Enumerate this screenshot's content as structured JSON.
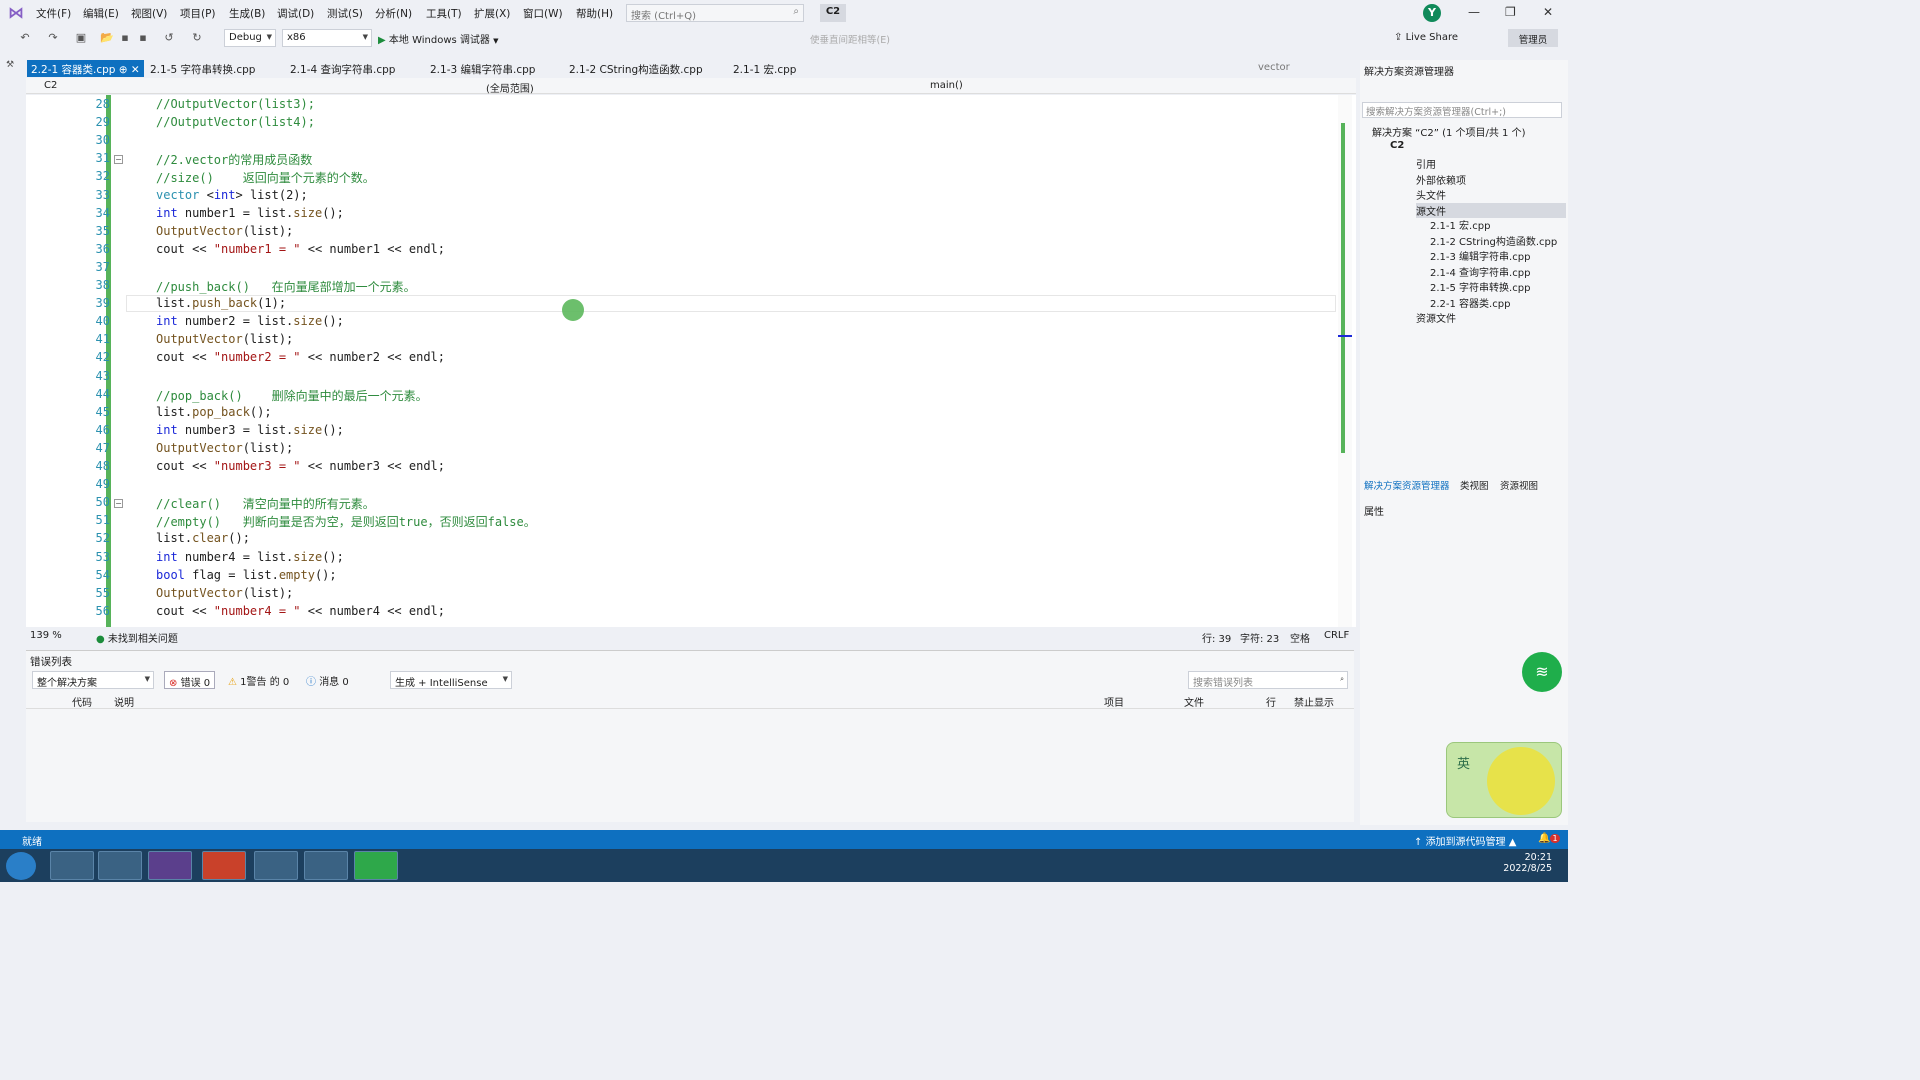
{
  "menu": [
    "文件(F)",
    "编辑(E)",
    "视图(V)",
    "项目(P)",
    "生成(B)",
    "调试(D)",
    "测试(S)",
    "分析(N)",
    "工具(T)",
    "扩展(X)",
    "窗口(W)",
    "帮助(H)"
  ],
  "search_placeholder": "搜索 (Ctrl+Q)",
  "solution_badge": "C2",
  "avatar_letter": "Y",
  "toolbar": {
    "config": "Debug",
    "platform": "x86",
    "run_label": "本地 Windows 调试器",
    "live_share": "Live Share",
    "admin": "管理员",
    "disabled_label": "使垂直间距相等(E)"
  },
  "tabs": [
    {
      "label": "2.2-1 容器类.cpp",
      "active": true
    },
    {
      "label": "2.1-5 字符串转换.cpp"
    },
    {
      "label": "2.1-4 查询字符串.cpp"
    },
    {
      "label": "2.1-3 编辑字符串.cpp"
    },
    {
      "label": "2.1-2 CString构造函数.cpp"
    },
    {
      "label": "2.1-1 宏.cpp"
    }
  ],
  "tab_overflow": "vector",
  "nav": {
    "project": "C2",
    "scope": "(全局范围)",
    "member": "main()"
  },
  "lines": [
    {
      "n": "28",
      "t": "//OutputVector(list3);"
    },
    {
      "n": "29",
      "t": "//OutputVector(list4);"
    },
    {
      "n": "30",
      "t": ""
    },
    {
      "n": "31",
      "t": "//2.vector的常用成员函数"
    },
    {
      "n": "32",
      "t": "//size()    返回向量个元素的个数。"
    },
    {
      "n": "33",
      "t": "vector <int> list(2);"
    },
    {
      "n": "34",
      "t": "int number1 = list.size();"
    },
    {
      "n": "35",
      "t": "OutputVector(list);"
    },
    {
      "n": "36",
      "t": "cout << \"number1 = \" << number1 << endl;"
    },
    {
      "n": "37",
      "t": ""
    },
    {
      "n": "38",
      "t": "//push_back()   在向量尾部增加一个元素。"
    },
    {
      "n": "39",
      "t": "list.push_back(1);"
    },
    {
      "n": "40",
      "t": "int number2 = list.size();"
    },
    {
      "n": "41",
      "t": "OutputVector(list);"
    },
    {
      "n": "42",
      "t": "cout << \"number2 = \" << number2 << endl;"
    },
    {
      "n": "43",
      "t": ""
    },
    {
      "n": "44",
      "t": "//pop_back()    删除向量中的最后一个元素。"
    },
    {
      "n": "45",
      "t": "list.pop_back();"
    },
    {
      "n": "46",
      "t": "int number3 = list.size();"
    },
    {
      "n": "47",
      "t": "OutputVector(list);"
    },
    {
      "n": "48",
      "t": "cout << \"number3 = \" << number3 << endl;"
    },
    {
      "n": "49",
      "t": ""
    },
    {
      "n": "50",
      "t": "//clear()   清空向量中的所有元素。"
    },
    {
      "n": "51",
      "t": "//empty()   判断向量是否为空，是则返回true，否则返回false。"
    },
    {
      "n": "52",
      "t": "list.clear();"
    },
    {
      "n": "53",
      "t": "int number4 = list.size();"
    },
    {
      "n": "54",
      "t": "bool flag = list.empty();"
    },
    {
      "n": "55",
      "t": "OutputVector(list);"
    },
    {
      "n": "56",
      "t": "cout << \"number4 = \" << number4 << endl;"
    }
  ],
  "editor_status": {
    "zoom": "139 %",
    "issues": "未找到相关问题",
    "line": "行: 39",
    "char": "字符: 23",
    "spaces": "空格",
    "eol": "CRLF"
  },
  "errors": {
    "title": "错误列表",
    "scope": "整个解决方案",
    "err": "错误 0",
    "warn": "1警告 的 0",
    "msg": "消息 0",
    "build": "生成 + IntelliSense",
    "search": "搜索错误列表",
    "cols": [
      "代码",
      "说明",
      "项目",
      "文件",
      "行",
      "禁止显示"
    ]
  },
  "solution_explorer": {
    "title": "解决方案资源管理器",
    "search": "搜索解决方案资源管理器(Ctrl+;)",
    "root": "解决方案 “C2” (1 个项目/共 1 个)",
    "project": "C2",
    "nodes": [
      "引用",
      "外部依赖项",
      "头文件",
      "源文件"
    ],
    "files": [
      "2.1-1 宏.cpp",
      "2.1-2 CString构造函数.cpp",
      "2.1-3 编辑字符串.cpp",
      "2.1-4 查询字符串.cpp",
      "2.1-5 字符串转换.cpp",
      "2.2-1 容器类.cpp"
    ],
    "resources": "资源文件",
    "bottom_tabs": [
      "解决方案资源管理器",
      "类视图",
      "资源视图"
    ],
    "properties": "属性"
  },
  "statusbar": {
    "ready": "就绪",
    "source_control": "添加到源代码管理",
    "notify": "1"
  },
  "clock": {
    "time": "20:21",
    "date": "2022/8/25"
  },
  "ime_label": "英"
}
